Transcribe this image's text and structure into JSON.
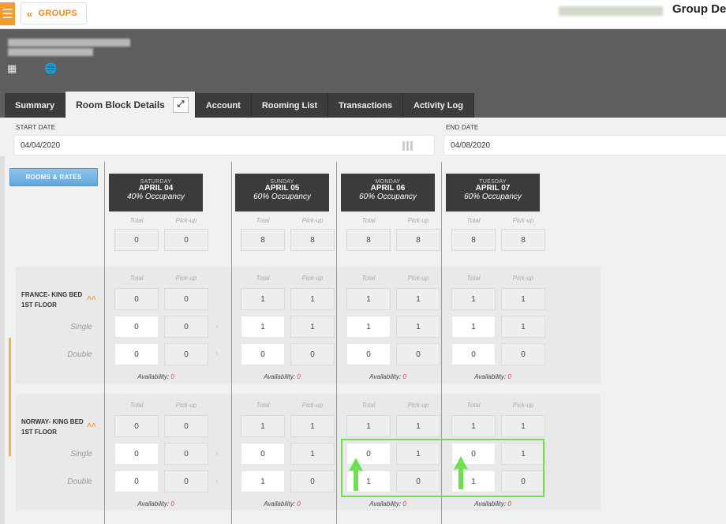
{
  "topbar": {
    "groups_label": "GROUPS",
    "page_title": "Group De"
  },
  "tabs": [
    {
      "label": "Summary"
    },
    {
      "label": "Room Block Details",
      "active": true
    },
    {
      "label": "Account"
    },
    {
      "label": "Rooming List"
    },
    {
      "label": "Transactions"
    },
    {
      "label": "Activity Log"
    }
  ],
  "dates": {
    "start_label": "START DATE",
    "start_value": "04/04/2020",
    "end_label": "END DATE",
    "end_value": "04/08/2020"
  },
  "rooms_button_label": "ROOMS & RATES",
  "labels": {
    "total": "Total",
    "pickup": "Pick-up",
    "single": "Single",
    "double": "Double",
    "availability": "Availability:"
  },
  "days": [
    {
      "dow": "SATURDAY",
      "date": "APRIL 04",
      "occupancy": "40% Occupancy",
      "total": "0",
      "pickup": "0"
    },
    {
      "dow": "SUNDAY",
      "date": "APRIL 05",
      "occupancy": "60% Occupancy",
      "total": "8",
      "pickup": "8"
    },
    {
      "dow": "MONDAY",
      "date": "APRIL 06",
      "occupancy": "60% Occupancy",
      "total": "8",
      "pickup": "8"
    },
    {
      "dow": "TUESDAY",
      "date": "APRIL 07",
      "occupancy": "60% Occupancy",
      "total": "8",
      "pickup": "8"
    }
  ],
  "rooms": [
    {
      "name_line1": "FRANCE- KING BED",
      "name_line2": "1ST FLOOR",
      "days": [
        {
          "total": [
            "0",
            "0"
          ],
          "single": [
            "0",
            "0"
          ],
          "double": [
            "0",
            "0"
          ],
          "availability": "0"
        },
        {
          "total": [
            "1",
            "1"
          ],
          "single": [
            "1",
            "1"
          ],
          "double": [
            "0",
            "0"
          ],
          "availability": "0"
        },
        {
          "total": [
            "1",
            "1"
          ],
          "single": [
            "1",
            "1"
          ],
          "double": [
            "0",
            "0"
          ],
          "availability": "0"
        },
        {
          "total": [
            "1",
            "1"
          ],
          "single": [
            "1",
            "1"
          ],
          "double": [
            "0",
            "0"
          ],
          "availability": "0"
        }
      ]
    },
    {
      "name_line1": "NORWAY- KING BED",
      "name_line2": "1ST FLOOR",
      "days": [
        {
          "total": [
            "0",
            "0"
          ],
          "single": [
            "0",
            "0"
          ],
          "double": [
            "0",
            "0"
          ],
          "availability": "0"
        },
        {
          "total": [
            "1",
            "1"
          ],
          "single": [
            "0",
            "1"
          ],
          "double": [
            "1",
            "0"
          ],
          "availability": "0"
        },
        {
          "total": [
            "1",
            "1"
          ],
          "single": [
            "0",
            "1"
          ],
          "double": [
            "1",
            "0"
          ],
          "availability": "0"
        },
        {
          "total": [
            "1",
            "1"
          ],
          "single": [
            "0",
            "1"
          ],
          "double": [
            "1",
            "0"
          ],
          "availability": "0"
        }
      ]
    }
  ],
  "colors": {
    "accent_orange": "#f29d2b",
    "highlight_green": "#6ee04e",
    "availability_red": "#e63a2c"
  }
}
